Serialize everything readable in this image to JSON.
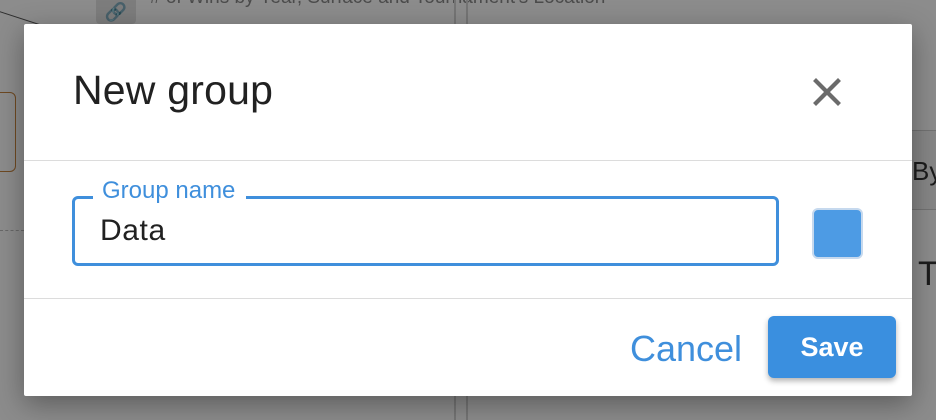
{
  "background": {
    "chart_title": "# of Wins by Year, Surface and Tournament's Location",
    "link_icon": "link-icon",
    "column_header": "By",
    "column_letter": "T"
  },
  "dialog": {
    "title": "New group",
    "close_icon": "close-icon",
    "name_field": {
      "label": "Group name",
      "value": "Data"
    },
    "color_swatch": {
      "color": "#4d9be4"
    },
    "actions": {
      "cancel_label": "Cancel",
      "save_label": "Save"
    }
  },
  "colors": {
    "accent": "#3f8fdc",
    "save_bg": "#3a8fdf",
    "cancel_text": "#3f8fdc"
  }
}
